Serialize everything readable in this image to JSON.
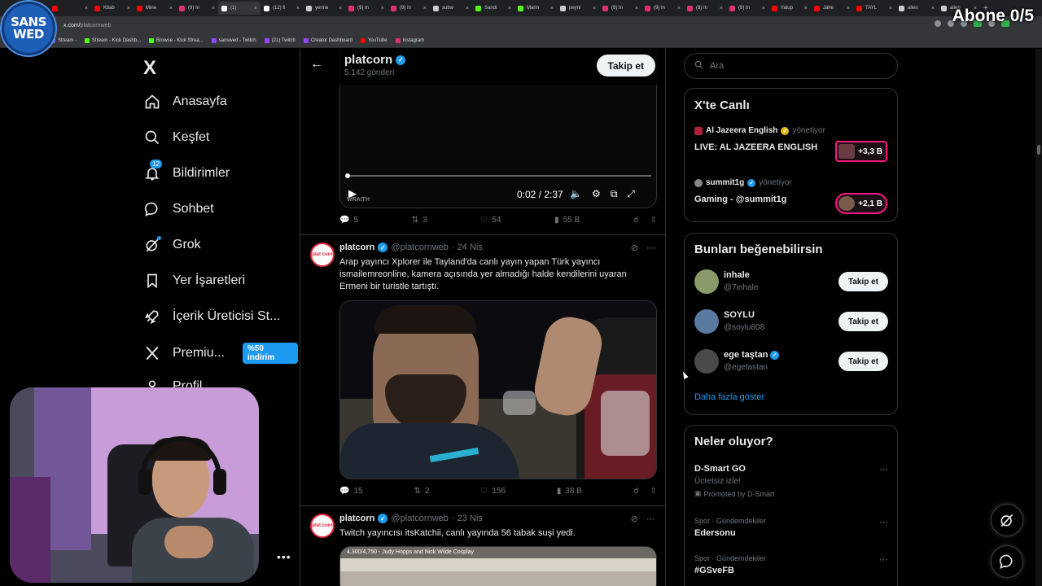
{
  "browser": {
    "tabs": [
      {
        "label": "",
        "color": "#ff0000"
      },
      {
        "label": "Kitab",
        "color": "#ff0000"
      },
      {
        "label": "Mine",
        "color": "#ff0000"
      },
      {
        "label": "(9) In",
        "color": "#e1306c"
      },
      {
        "label": "(1)",
        "color": "#ffffff",
        "active": true
      },
      {
        "label": "(12) fi",
        "color": "#ffffff"
      },
      {
        "label": "yenne",
        "color": "#cccccc"
      },
      {
        "label": "(9) In",
        "color": "#e1306c"
      },
      {
        "label": "(9) In",
        "color": "#e1306c"
      },
      {
        "label": "subw",
        "color": "#cccccc"
      },
      {
        "label": "Sandi",
        "color": "#53fc18"
      },
      {
        "label": "Marin",
        "color": "#53fc18"
      },
      {
        "label": "peyni",
        "color": "#cccccc"
      },
      {
        "label": "(9) In",
        "color": "#e1306c"
      },
      {
        "label": "(9) In",
        "color": "#e1306c"
      },
      {
        "label": "(9) In",
        "color": "#e1306c"
      },
      {
        "label": "(9) In",
        "color": "#e1306c"
      },
      {
        "label": "Yalup",
        "color": "#ff0000"
      },
      {
        "label": "Jahe",
        "color": "#ff0000"
      },
      {
        "label": "TAYL",
        "color": "#ff0000"
      },
      {
        "label": "alien",
        "color": "#cccccc"
      },
      {
        "label": "alien",
        "color": "#cccccc"
      }
    ],
    "url_domain": "x.com/",
    "url_path": "platcornweb",
    "bookmarks": [
      {
        "label": "Stream -",
        "color": "#9146ff"
      },
      {
        "label": "Stream - Kick Dashb...",
        "color": "#53fc18"
      },
      {
        "label": "Browse - Kick Strea...",
        "color": "#53fc18"
      },
      {
        "label": "sanswed - Twitch",
        "color": "#9146ff"
      },
      {
        "label": "(21) Twitch",
        "color": "#9146ff"
      },
      {
        "label": "Creator Dashboard",
        "color": "#9146ff"
      },
      {
        "label": "YouTube",
        "color": "#ff0000"
      },
      {
        "label": "Instagram",
        "color": "#e1306c"
      }
    ]
  },
  "overlay": {
    "logo_line1": "SANS",
    "logo_line2": "WED",
    "abone": "Abone 0/5"
  },
  "nav": {
    "logo": "X",
    "items": [
      {
        "label": "Anasayfa",
        "icon": "home-icon"
      },
      {
        "label": "Keşfet",
        "icon": "search-icon"
      },
      {
        "label": "Bildirimler",
        "icon": "bell-icon",
        "badge": "12"
      },
      {
        "label": "Sohbet",
        "icon": "chat-icon"
      },
      {
        "label": "Grok",
        "icon": "grok-icon"
      },
      {
        "label": "Yer İşaretleri",
        "icon": "bookmark-icon"
      },
      {
        "label": "İçerik Üreticisi St...",
        "icon": "rocket-icon"
      },
      {
        "label": "Premiu...",
        "icon": "x-icon",
        "tag": "%50 indirim"
      },
      {
        "label": "Profil",
        "icon": "profile-icon"
      }
    ],
    "more": "•••"
  },
  "timeline": {
    "name": "platcorn",
    "count": "5.142 gönderi",
    "follow": "Takip et",
    "video": {
      "time": "0:02 / 2:37",
      "watermark": "WRAITH"
    },
    "post0_actions": {
      "replies": "5",
      "reposts": "3",
      "likes": "54",
      "views": "55 B"
    },
    "posts": [
      {
        "avatar": "plat corn",
        "name": "platcorn",
        "handle": "@platcornweb",
        "date": "· 24 Nis",
        "text": "Arap yayıncı Xplorer ile Tayland'da canlı yayın yapan Türk yayıncı ismailemreonline, kamera açısında yer almadığı halde kendilerini uyaran Ermeni bir turistle tartıştı.",
        "replies": "15",
        "reposts": "2",
        "likes": "156",
        "views": "38 B"
      },
      {
        "avatar": "plat corn",
        "name": "platcorn",
        "handle": "@platcornweb",
        "date": "· 23 Nis",
        "text": "Twitch yayıncısı itsKatchii, canlı yayında 56 tabak suşi yedi.",
        "image_caption": "4,300/4,750 - Judy Hopps and Nick Wilde Cosplay"
      }
    ]
  },
  "sidebar": {
    "search_placeholder": "Ara",
    "live": {
      "title": "X'te Canlı",
      "items": [
        {
          "host": "Al Jazeera English",
          "status": "yönetiyor",
          "title": "LIVE: AL JAZEERA ENGLISH",
          "count": "+3,3 B"
        },
        {
          "host": "summit1g",
          "status": "yönetiyor",
          "title": "Gaming - @summit1g",
          "count": "+2,1 B"
        }
      ]
    },
    "suggest": {
      "title": "Bunları beğenebilirsin",
      "items": [
        {
          "name": "inhale",
          "handle": "@7inhale",
          "button": "Takip et"
        },
        {
          "name": "SOYLU",
          "handle": "@soylu808",
          "button": "Takip et"
        },
        {
          "name": "ege taştan",
          "handle": "@egetastan",
          "button": "Takip et",
          "verified": true
        }
      ],
      "more": "Daha fazla göster"
    },
    "trends": {
      "title": "Neler oluyor?",
      "items": [
        {
          "category": "",
          "title": "D-Smart GO",
          "subtitle": "Ücretsiz izle!",
          "promo": "Promoted by D-Smart"
        },
        {
          "category": "Spor · Gündemdekiler",
          "title": "Edersonu"
        },
        {
          "category": "Spor · Gündemdekiler",
          "title": "#GSveFB"
        }
      ]
    }
  }
}
